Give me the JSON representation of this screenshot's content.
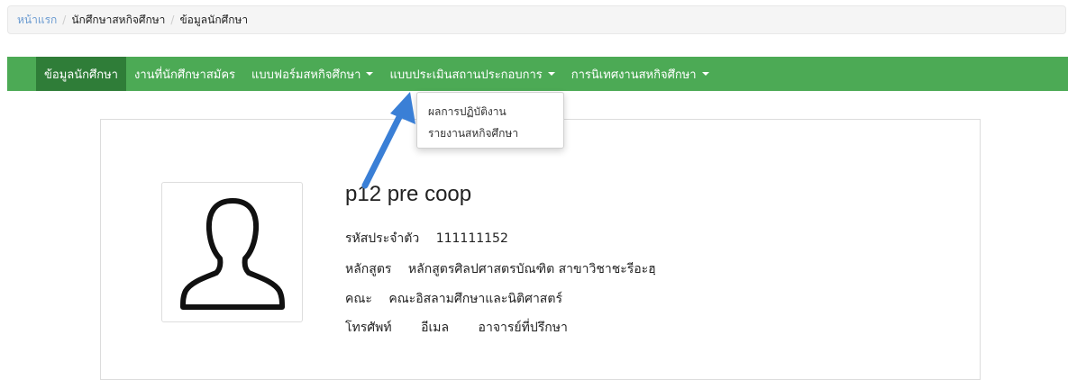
{
  "breadcrumb": {
    "home": "หน้าแรก",
    "section": "นักศึกษาสหกิจศึกษา",
    "current": "ข้อมูลนักศึกษา"
  },
  "navbar": {
    "items": [
      {
        "label": "ข้อมูลนักศึกษา",
        "active": true,
        "has_caret": false
      },
      {
        "label": "งานที่นักศึกษาสมัคร",
        "active": false,
        "has_caret": false
      },
      {
        "label": "แบบฟอร์มสหกิจศึกษา",
        "active": false,
        "has_caret": true
      },
      {
        "label": "แบบประเมินสถานประกอบการ",
        "active": false,
        "has_caret": true
      },
      {
        "label": "การนิเทศงานสหกิจศึกษา",
        "active": false,
        "has_caret": true
      }
    ],
    "color": "#4caa55",
    "active_color": "#2f7d38"
  },
  "dropdown": {
    "items": [
      "ผลการปฏิบัติงาน",
      "รายงานสหกิจศึกษา"
    ]
  },
  "profile": {
    "name": "p12 pre coop",
    "student_id_label": "รหัสประจำตัว",
    "student_id": "111111152",
    "program_label": "หลักสูตร",
    "program": "หลักสูตรศิลปศาสตรบัณฑิต สาขาวิชาชะรีอะฮฺ",
    "faculty_label": "คณะ",
    "faculty": "คณะอิสลามศึกษาและนิติศาสตร์",
    "phone_label": "โทรศัพท์",
    "email_label": "อีเมล",
    "advisor_label": "อาจารย์ที่ปรึกษา",
    "avatar_icon": "user-silhouette-icon"
  },
  "annotation": {
    "arrow_color": "#3a7fd6"
  }
}
